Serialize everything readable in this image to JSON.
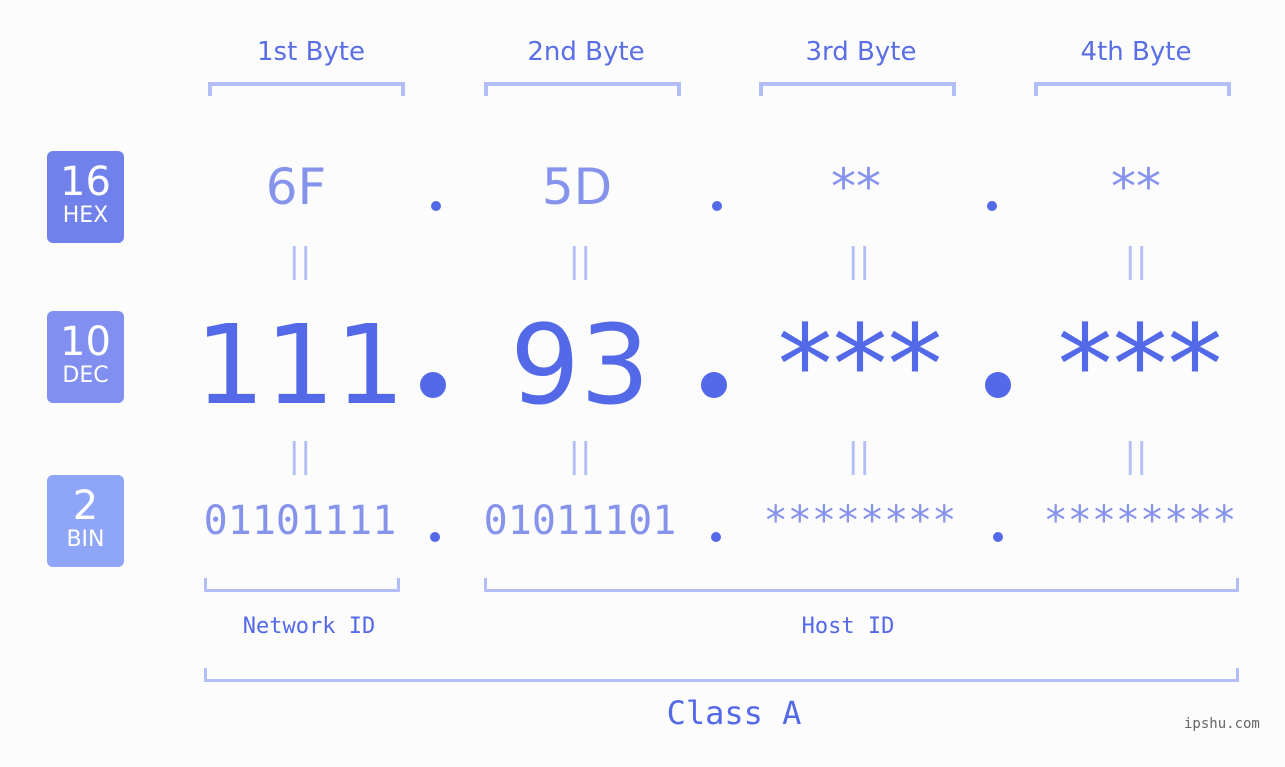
{
  "badges": [
    {
      "base": "16",
      "label": "HEX",
      "color": "#7181ec"
    },
    {
      "base": "10",
      "label": "DEC",
      "color": "#8190f0"
    },
    {
      "base": "2",
      "label": "BIN",
      "color": "#8fa6f8"
    }
  ],
  "bytes": [
    {
      "header": "1st Byte",
      "hex": "6F",
      "dec": "111",
      "bin": "01101111"
    },
    {
      "header": "2nd Byte",
      "hex": "5D",
      "dec": "93",
      "bin": "01011101"
    },
    {
      "header": "3rd Byte",
      "hex": "**",
      "dec": "***",
      "bin": "********"
    },
    {
      "header": "4th Byte",
      "hex": "**",
      "dec": "***",
      "bin": "********"
    }
  ],
  "equals_symbol": "||",
  "network_label": "Network ID",
  "host_label": "Host ID",
  "class_label": "Class A",
  "watermark": "ipshu.com",
  "colors": {
    "accent": "#5469e8",
    "light": "#8593ec",
    "bracket": "#b3bdf7",
    "background": "#fbfcfb"
  }
}
